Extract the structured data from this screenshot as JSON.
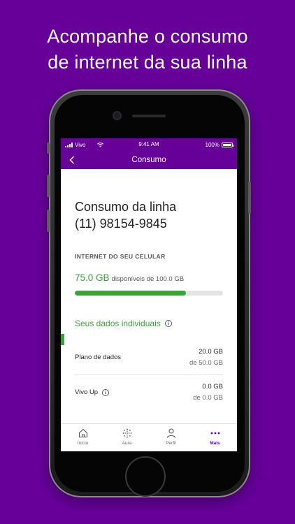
{
  "headline": {
    "line1": "Acompanhe o consumo",
    "line2": "de internet da sua linha"
  },
  "status_bar": {
    "carrier": "Vivo",
    "time": "9:41 AM",
    "battery": "100%"
  },
  "nav": {
    "title": "Consumo",
    "back_icon": "chevron-left-icon"
  },
  "main": {
    "title_line1": "Consumo da linha",
    "title_line2": "(11) 98154-9845",
    "section_label": "INTERNET DO SEU CELULAR",
    "available_gb": "75.0 GB",
    "available_rest": "disponíveis de 100.0 GB",
    "usage_fraction": 0.75,
    "individual_link": "Seus dados individuais",
    "rows": [
      {
        "label": "Plano de dados",
        "value": "20.0 GB",
        "sub": "de 50.0 GB"
      },
      {
        "label": "Vivo Up",
        "value": "0.0 GB",
        "sub": "de 0.0 GB"
      }
    ]
  },
  "tabbar": {
    "items": [
      {
        "label": "Início",
        "icon": "home-icon"
      },
      {
        "label": "Aura",
        "icon": "aura-icon"
      },
      {
        "label": "Perfil",
        "icon": "person-icon"
      },
      {
        "label": "Mais",
        "icon": "more-icon"
      }
    ]
  },
  "colors": {
    "brand": "#660099",
    "accent_green": "#38a339"
  }
}
